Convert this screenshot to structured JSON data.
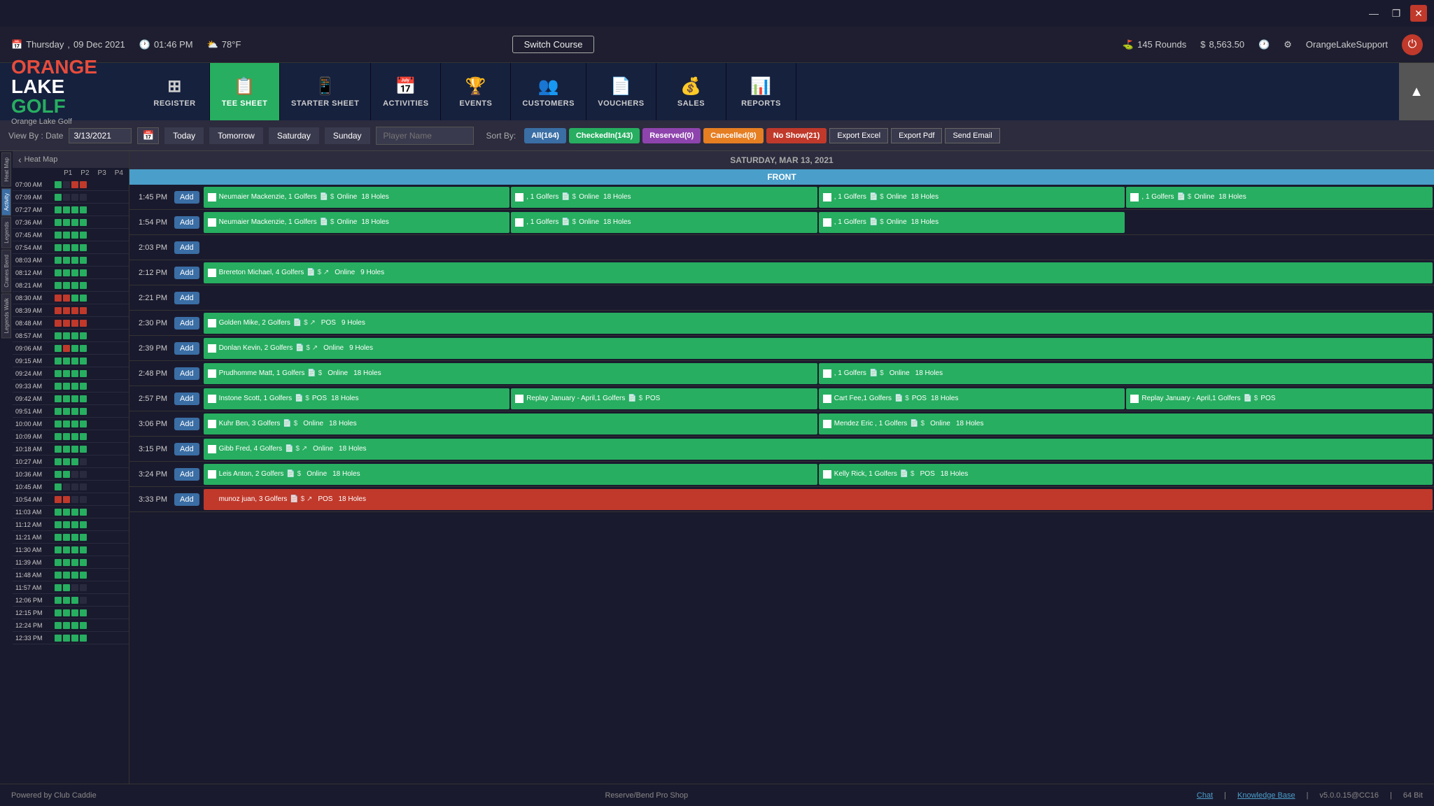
{
  "titleBar": {
    "minimizeLabel": "—",
    "restoreLabel": "❐",
    "closeLabel": "✕"
  },
  "topBar": {
    "dayOfWeek": "Thursday",
    "date": "09 Dec 2021",
    "time": "01:46 PM",
    "weather": "78°F",
    "switchCourse": "Switch Course",
    "rounds": "145 Rounds",
    "sales": "8,563.50",
    "username": "OrangeLakeSupport"
  },
  "nav": {
    "items": [
      {
        "id": "register",
        "label": "REGISTER",
        "icon": "⊞"
      },
      {
        "id": "teesheet",
        "label": "TEE SHEET",
        "icon": "📋"
      },
      {
        "id": "starter",
        "label": "STARTER SHEET",
        "icon": "📱"
      },
      {
        "id": "activities",
        "label": "ACTIVITIES",
        "icon": "📅"
      },
      {
        "id": "events",
        "label": "EVENTS",
        "icon": "🏆"
      },
      {
        "id": "customers",
        "label": "CUSTOMERS",
        "icon": "👥"
      },
      {
        "id": "vouchers",
        "label": "VOUCHERS",
        "icon": "📄"
      },
      {
        "id": "sales",
        "label": "SALES",
        "icon": "💰"
      },
      {
        "id": "reports",
        "label": "REPORTS",
        "icon": "📊"
      }
    ],
    "logoLine1": "ORANGE",
    "logoLine2": "LAKE",
    "logoLine3": "GOLF",
    "logoSub": "Orange Lake Golf"
  },
  "viewBar": {
    "viewByLabel": "View By : Date",
    "dateValue": "3/13/2021",
    "todayLabel": "Today",
    "tomorrowLabel": "Tomorrow",
    "saturdayLabel": "Saturday",
    "sundayLabel": "Sunday",
    "playerNamePlaceholder": "Player Name",
    "sortByLabel": "Sort By:",
    "allLabel": "All(164)",
    "checkedInLabel": "CheckedIn(143)",
    "reservedLabel": "Reserved(0)",
    "cancelledLabel": "Cancelled(8)",
    "noShowLabel": "No Show(21)",
    "exportExcelLabel": "Export Excel",
    "exportPdfLabel": "Export Pdf",
    "sendEmailLabel": "Send Email"
  },
  "heatMap": {
    "title": "Heat Map",
    "cols": [
      "P1",
      "P2",
      "P3",
      "P4"
    ],
    "navPrev": "‹"
  },
  "leftSideTabs": [
    "Heat Map",
    "Activity",
    "Legends",
    "Cranes Bend",
    "Legends Walk"
  ],
  "teeSheet": {
    "dateHeader": "SATURDAY, MAR 13, 2021",
    "frontHeader": "FRONT",
    "times": [
      {
        "time": "07:00 AM",
        "cells": [
          "green",
          "empty",
          "red",
          "red"
        ]
      },
      {
        "time": "07:09 AM",
        "cells": [
          "green",
          "empty",
          "empty",
          "empty"
        ]
      },
      {
        "time": "07:27 AM",
        "cells": [
          "green",
          "green",
          "green",
          "green"
        ]
      },
      {
        "time": "07:36 AM",
        "cells": [
          "green",
          "green",
          "green",
          "green"
        ]
      },
      {
        "time": "07:45 AM",
        "cells": [
          "green",
          "green",
          "green",
          "green"
        ]
      },
      {
        "time": "07:54 AM",
        "cells": [
          "green",
          "green",
          "green",
          "green"
        ]
      },
      {
        "time": "08:03 AM",
        "cells": [
          "green",
          "green",
          "green",
          "green"
        ]
      },
      {
        "time": "08:12 AM",
        "cells": [
          "green",
          "green",
          "green",
          "green"
        ]
      },
      {
        "time": "08:21 AM",
        "cells": [
          "green",
          "green",
          "green",
          "green"
        ]
      },
      {
        "time": "08:30 AM",
        "cells": [
          "red",
          "red",
          "green",
          "green"
        ]
      },
      {
        "time": "08:39 AM",
        "cells": [
          "red",
          "red",
          "red",
          "red"
        ]
      },
      {
        "time": "08:48 AM",
        "cells": [
          "red",
          "red",
          "red",
          "red"
        ]
      },
      {
        "time": "08:57 AM",
        "cells": [
          "green",
          "green",
          "green",
          "green"
        ]
      },
      {
        "time": "09:06 AM",
        "cells": [
          "green",
          "red",
          "green",
          "green"
        ]
      },
      {
        "time": "09:15 AM",
        "cells": [
          "green",
          "green",
          "green",
          "green"
        ]
      },
      {
        "time": "09:24 AM",
        "cells": [
          "green",
          "green",
          "green",
          "green"
        ]
      },
      {
        "time": "09:33 AM",
        "cells": [
          "green",
          "green",
          "green",
          "green"
        ]
      },
      {
        "time": "09:42 AM",
        "cells": [
          "green",
          "green",
          "green",
          "green"
        ]
      },
      {
        "time": "09:51 AM",
        "cells": [
          "green",
          "green",
          "green",
          "green"
        ]
      },
      {
        "time": "10:00 AM",
        "cells": [
          "green",
          "green",
          "green",
          "green"
        ]
      },
      {
        "time": "10:09 AM",
        "cells": [
          "green",
          "green",
          "green",
          "green"
        ]
      },
      {
        "time": "10:18 AM",
        "cells": [
          "green",
          "green",
          "green",
          "green"
        ]
      },
      {
        "time": "10:27 AM",
        "cells": [
          "green",
          "green",
          "green",
          "empty"
        ]
      },
      {
        "time": "10:36 AM",
        "cells": [
          "green",
          "green",
          "empty",
          "empty"
        ]
      },
      {
        "time": "10:45 AM",
        "cells": [
          "green",
          "empty",
          "empty",
          "empty"
        ]
      },
      {
        "time": "10:54 AM",
        "cells": [
          "red",
          "red",
          "empty",
          "empty"
        ]
      },
      {
        "time": "11:03 AM",
        "cells": [
          "green",
          "green",
          "green",
          "green"
        ]
      },
      {
        "time": "11:12 AM",
        "cells": [
          "green",
          "green",
          "green",
          "green"
        ]
      },
      {
        "time": "11:21 AM",
        "cells": [
          "green",
          "green",
          "green",
          "green"
        ]
      },
      {
        "time": "11:30 AM",
        "cells": [
          "green",
          "green",
          "green",
          "green"
        ]
      },
      {
        "time": "11:39 AM",
        "cells": [
          "green",
          "green",
          "green",
          "green"
        ]
      },
      {
        "time": "11:48 AM",
        "cells": [
          "green",
          "green",
          "green",
          "green"
        ]
      },
      {
        "time": "11:57 AM",
        "cells": [
          "green",
          "green",
          "empty",
          "empty"
        ]
      },
      {
        "time": "12:06 PM",
        "cells": [
          "green",
          "green",
          "green",
          "empty"
        ]
      },
      {
        "time": "12:15 PM",
        "cells": [
          "green",
          "green",
          "green",
          "green"
        ]
      },
      {
        "time": "12:24 PM",
        "cells": [
          "green",
          "green",
          "green",
          "green"
        ]
      },
      {
        "time": "12:33 PM",
        "cells": [
          "green",
          "green",
          "green",
          "green"
        ]
      }
    ]
  },
  "teeRows": [
    {
      "time": "1:45 PM",
      "slots": [
        {
          "name": "Neumaier Mackenzie, 1 Golfers",
          "type": "Online",
          "holes": "18 Holes",
          "color": "green"
        },
        {
          "name": ", 1 Golfers",
          "type": "Online",
          "holes": "18 Holes",
          "color": "green"
        },
        {
          "name": ", 1 Golfers",
          "type": "Online",
          "holes": "18 Holes",
          "color": "green"
        },
        {
          "name": ", 1 Golfers",
          "type": "Online",
          "holes": "18 Holes",
          "color": "green"
        }
      ]
    },
    {
      "time": "1:54 PM",
      "slots": [
        {
          "name": "Neumaier Mackenzie, 1 Golfers",
          "type": "Online",
          "holes": "18 Holes",
          "color": "green"
        },
        {
          "name": ", 1 Golfers",
          "type": "Online",
          "holes": "18 Holes",
          "color": "green"
        },
        {
          "name": ", 1 Golfers",
          "type": "Online",
          "holes": "18 Holes",
          "color": "green"
        },
        {
          "name": "",
          "type": "",
          "holes": "",
          "color": "empty"
        }
      ]
    },
    {
      "time": "2:03 PM",
      "slots": []
    },
    {
      "time": "2:12 PM",
      "slots": [
        {
          "name": "Brereton Michael, 4 Golfers",
          "type": "Online",
          "holes": "9 Holes",
          "color": "green",
          "wide": true
        }
      ]
    },
    {
      "time": "2:21 PM",
      "slots": []
    },
    {
      "time": "2:30 PM",
      "slots": [
        {
          "name": "Golden Mike, 2 Golfers",
          "type": "POS",
          "holes": "9 Holes",
          "color": "green",
          "wide": true
        }
      ]
    },
    {
      "time": "2:39 PM",
      "slots": [
        {
          "name": "Donlan Kevin, 2 Golfers",
          "type": "Online",
          "holes": "9 Holes",
          "color": "green",
          "wide": true
        }
      ]
    },
    {
      "time": "2:48 PM",
      "slots": [
        {
          "name": "Prudhomme Matt, 1 Golfers",
          "type": "Online",
          "holes": "18 Holes",
          "color": "green",
          "half": true
        },
        {
          "name": ", 1 Golfers",
          "type": "Online",
          "holes": "18 Holes",
          "color": "green",
          "half": true
        }
      ]
    },
    {
      "time": "2:57 PM",
      "slots": [
        {
          "name": "Instone Scott, 1 Golfers",
          "type": "POS",
          "holes": "18 Holes",
          "color": "green"
        },
        {
          "name": "Replay January - April,1 Golfers",
          "type": "POS",
          "holes": "",
          "color": "green"
        },
        {
          "name": "Cart Fee,1 Golfers",
          "type": "POS",
          "holes": "18 Holes",
          "color": "green"
        },
        {
          "name": "Replay January - April,1 Golfers",
          "type": "POS",
          "holes": "",
          "color": "green"
        }
      ]
    },
    {
      "time": "3:06 PM",
      "slots": [
        {
          "name": "Kuhr Ben, 3 Golfers",
          "type": "Online",
          "holes": "18 Holes",
          "color": "green",
          "half": true
        },
        {
          "name": "Mendez Eric , 1 Golfers",
          "type": "Online",
          "holes": "18 Holes",
          "color": "green",
          "half": true
        }
      ]
    },
    {
      "time": "3:15 PM",
      "slots": [
        {
          "name": "Gibb Fred, 4 Golfers",
          "type": "Online",
          "holes": "18 Holes",
          "color": "green",
          "wide": true
        }
      ]
    },
    {
      "time": "3:24 PM",
      "slots": [
        {
          "name": "Leis Anton, 2 Golfers",
          "type": "Online",
          "holes": "18 Holes",
          "color": "green",
          "half": true
        },
        {
          "name": "Kelly Rick, 1 Golfers",
          "type": "POS",
          "holes": "18 Holes",
          "color": "green",
          "half": true
        }
      ]
    },
    {
      "time": "3:33 PM",
      "slots": [
        {
          "name": "munoz juan, 3 Golfers",
          "type": "POS",
          "holes": "18 Holes",
          "color": "red",
          "wide": true
        }
      ]
    }
  ],
  "footer": {
    "poweredBy": "Powered by Club Caddie",
    "location": "Reserve/Bend Pro Shop",
    "chatLabel": "Chat",
    "knowledgeBaseLabel": "Knowledge Base",
    "version": "v5.0.0.15@CC16",
    "bitLabel": "64 Bit"
  }
}
